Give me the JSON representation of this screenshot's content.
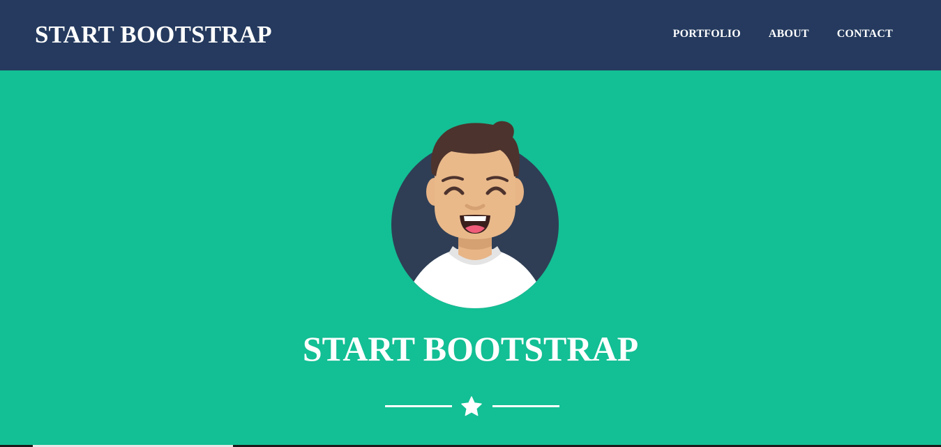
{
  "navbar": {
    "brand": "START BOOTSTRAP",
    "links": [
      {
        "label": "PORTFOLIO"
      },
      {
        "label": "ABOUT"
      },
      {
        "label": "CONTACT"
      }
    ]
  },
  "masthead": {
    "title": "START BOOTSTRAP",
    "divider_icon": "star-icon",
    "avatar_icon": "avatar-icon"
  },
  "colors": {
    "navbar_bg": "#253a5e",
    "masthead_bg": "#13bf94",
    "avatar_circle": "#2c3e50",
    "text": "#ffffff"
  }
}
